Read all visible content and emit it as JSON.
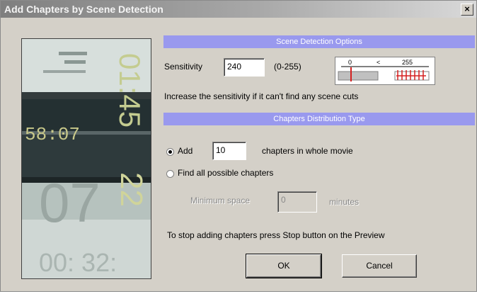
{
  "window": {
    "title": "Add Chapters by Scene Detection",
    "close_glyph": "×"
  },
  "preview": {
    "texts": [
      "58:07",
      "01:45",
      "22",
      "07",
      "00: 32:"
    ]
  },
  "scene_detection": {
    "header": "Scene Detection Options",
    "sensitivity_label": "Sensitivity",
    "sensitivity_value": "240",
    "range_text": "(0-255)",
    "hint": "Increase the sensitivity if it can't find any scene cuts",
    "slider": {
      "min_label": "0",
      "compare_label": "<",
      "max_label": "255"
    }
  },
  "distribution": {
    "header": "Chapters Distribution Type",
    "add_label": "Add",
    "add_value": "10",
    "add_suffix": "chapters in whole movie",
    "find_all_label": "Find all possible chapters",
    "min_space_label": "Minimum space",
    "min_space_value": "0",
    "minutes_label": "minutes",
    "selected": "add"
  },
  "footer_note": "To stop adding chapters press Stop button on the Preview",
  "buttons": {
    "ok": "OK",
    "cancel": "Cancel"
  },
  "colors": {
    "section_header": "#9999ee",
    "dialog_bg": "#d4d0c8",
    "slider_red": "#d42020"
  }
}
